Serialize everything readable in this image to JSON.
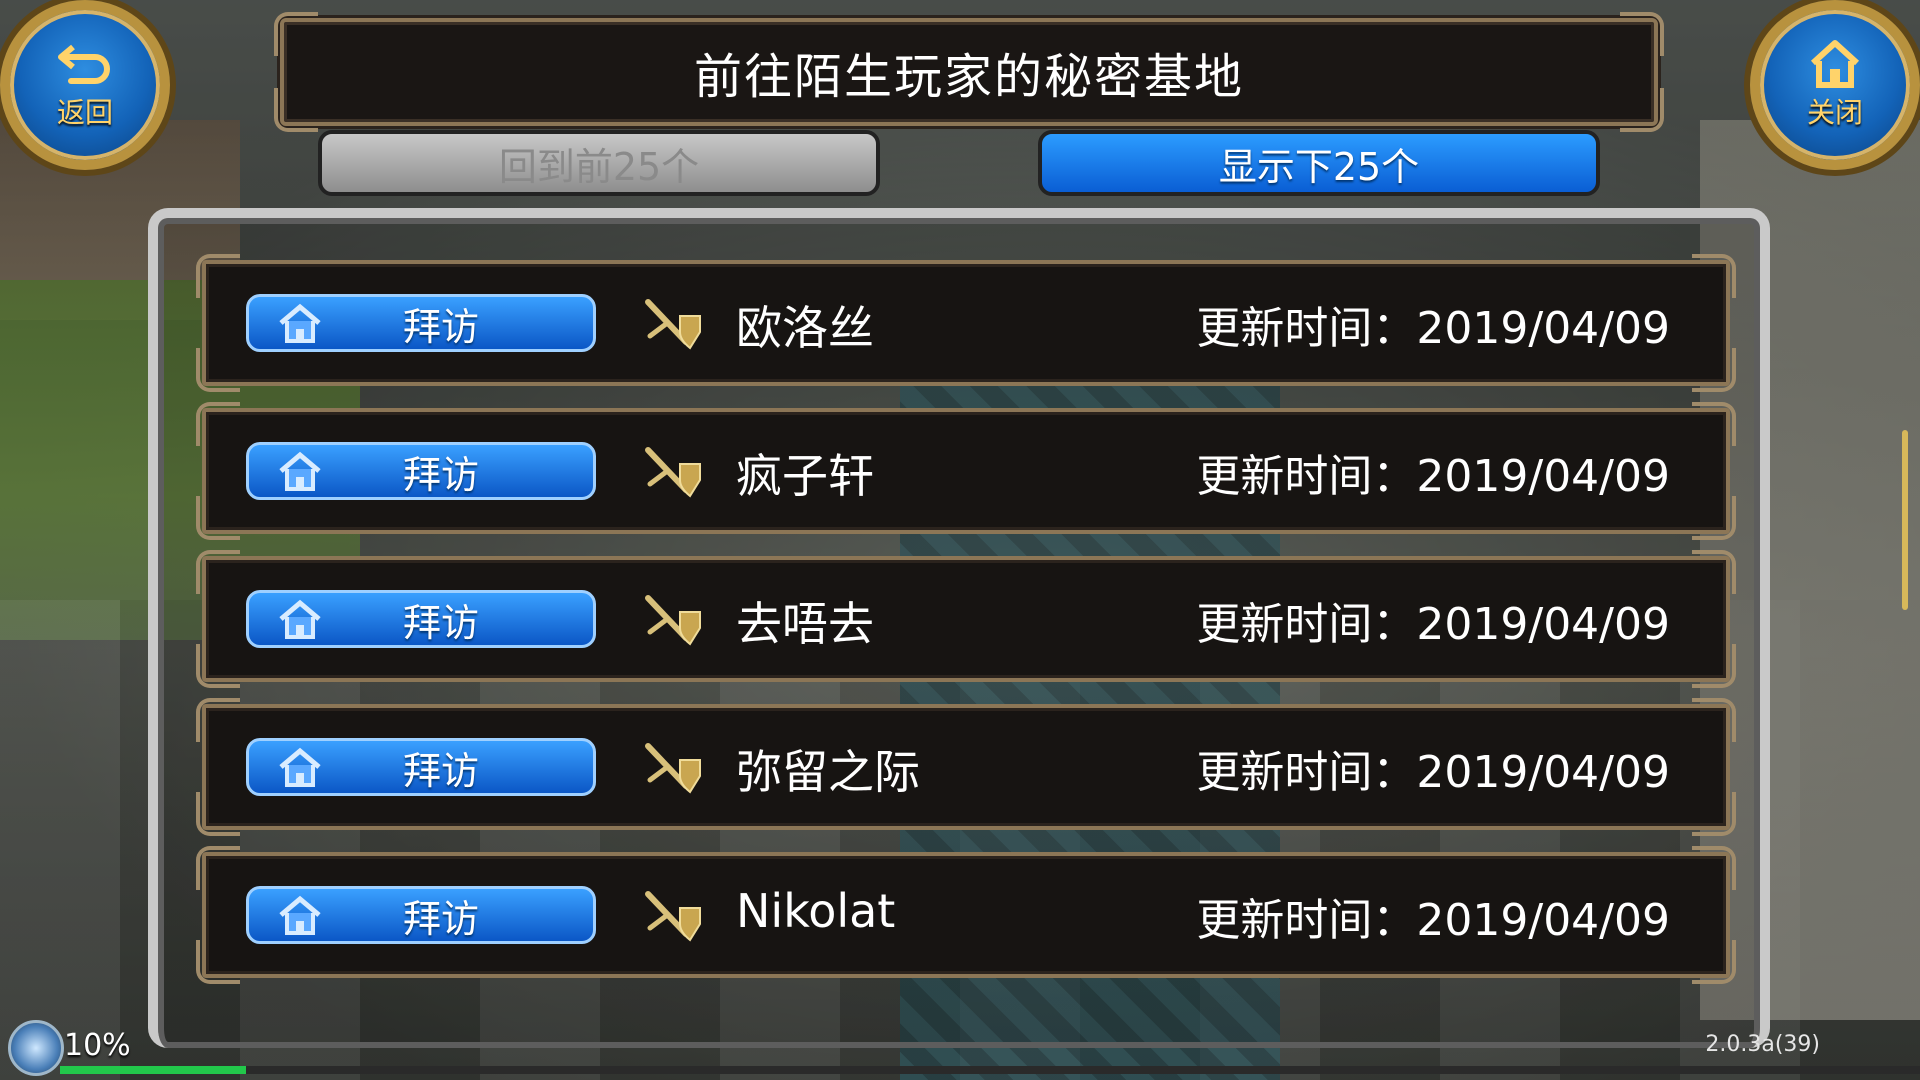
{
  "title": "前往陌生玩家的秘密基地",
  "back_button": {
    "label": "返回",
    "icon": "back-arrow-icon"
  },
  "close_button": {
    "label": "关闭",
    "icon": "house-icon"
  },
  "nav": {
    "prev_label": "回到前25个",
    "next_label": "显示下25个"
  },
  "entries": [
    {
      "visit_label": "拜访",
      "name": "欧洛丝",
      "update_time": "更新时间：2019/04/09"
    },
    {
      "visit_label": "拜访",
      "name": "疯子轩",
      "update_time": "更新时间：2019/04/09"
    },
    {
      "visit_label": "拜访",
      "name": "去唔去",
      "update_time": "更新时间：2019/04/09"
    },
    {
      "visit_label": "拜访",
      "name": "弥留之际",
      "update_time": "更新时间：2019/04/09"
    },
    {
      "visit_label": "拜访",
      "name": "Nikolat",
      "update_time": "更新时间：2019/04/09"
    }
  ],
  "hud": {
    "percent": "10%",
    "progress": 0.1,
    "version": "2.0.3a(39)"
  },
  "colors": {
    "accent_blue": "#0b57c6",
    "frame_gold": "#8c7656",
    "progress_green": "#22c84b"
  }
}
